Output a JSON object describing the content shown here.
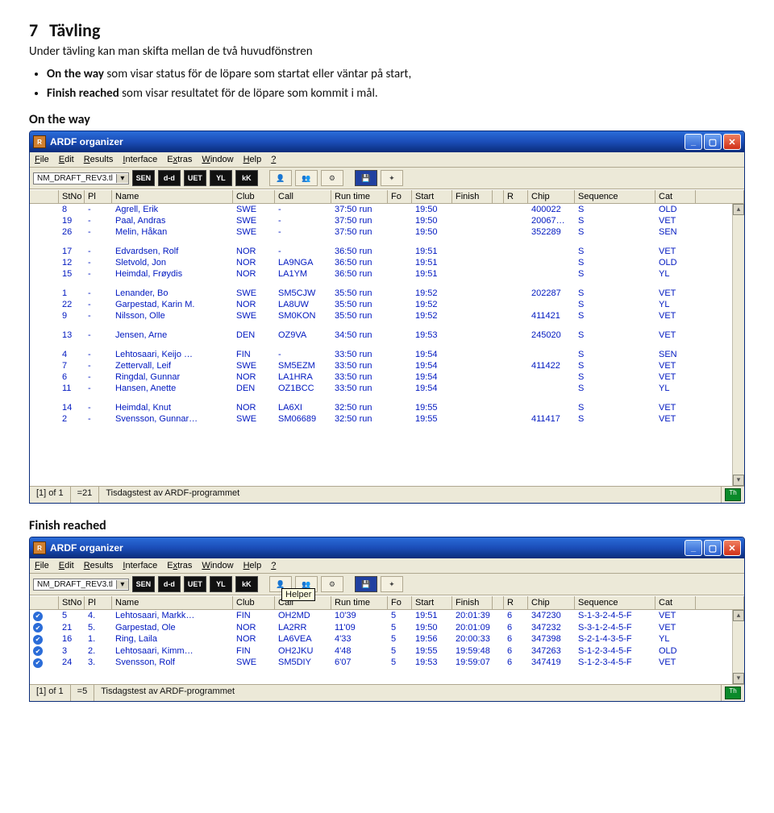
{
  "doc": {
    "section_no": "7",
    "section_title": "Tävling",
    "intro": "Under tävling kan man skifta mellan de två huvudfönstren",
    "bullets": [
      {
        "strong": "On the way",
        "rest": " som visar status för de löpare som startat eller väntar på start,"
      },
      {
        "strong": "Finish reached",
        "rest": " som visar resultatet för de löpare som kommit i mål."
      }
    ],
    "label_on_the_way": "On the way",
    "label_finish": "Finish reached"
  },
  "app": {
    "title": "ARDF organizer",
    "menus": [
      "File",
      "Edit",
      "Results",
      "Interface",
      "Extras",
      "Window",
      "Help",
      "?"
    ],
    "combo": "NM_DRAFT_REV3.tl",
    "toolbar": [
      "SEN",
      "d-d",
      "UET",
      "YL",
      "kK"
    ],
    "tooltip": "Helper",
    "headers": [
      "StNo",
      "Pl",
      "Name",
      "Club",
      "Call",
      "Run time",
      "Fo",
      "Start",
      "Finish",
      "",
      "R",
      "Chip",
      "Sequence",
      "Cat"
    ],
    "sysbtn": {
      "min": "_",
      "max": "▢",
      "close": "✕"
    },
    "status": {
      "page": "[1] of 1",
      "count1": "=21",
      "count2": "=5",
      "text": "Tisdagstest av ARDF-programmet"
    }
  },
  "ontheway": [
    [
      " ",
      "8",
      "-",
      "Agrell, Erik",
      "SWE",
      "-",
      "37:50 run",
      "",
      "19:50",
      "",
      "",
      "",
      "400022",
      "S",
      "OLD"
    ],
    [
      " ",
      "19",
      "-",
      "Paal, Andras",
      "SWE",
      "-",
      "37:50 run",
      "",
      "19:50",
      "",
      "",
      "",
      "20067…",
      "S",
      "VET"
    ],
    [
      " ",
      "26",
      "-",
      "Melin, Håkan",
      "SWE",
      "-",
      "37:50 run",
      "",
      "19:50",
      "",
      "",
      "",
      "352289",
      "S",
      "SEN"
    ],
    [
      "gap"
    ],
    [
      " ",
      "17",
      "-",
      "Edvardsen, Rolf",
      "NOR",
      "-",
      "36:50 run",
      "",
      "19:51",
      "",
      "",
      "",
      "",
      "S",
      "VET"
    ],
    [
      " ",
      "12",
      "-",
      "Sletvold, Jon",
      "NOR",
      "LA9NGA",
      "36:50 run",
      "",
      "19:51",
      "",
      "",
      "",
      "",
      "S",
      "OLD"
    ],
    [
      " ",
      "15",
      "-",
      "Heimdal, Frøydis",
      "NOR",
      "LA1YM",
      "36:50 run",
      "",
      "19:51",
      "",
      "",
      "",
      "",
      "S",
      "YL"
    ],
    [
      "gap"
    ],
    [
      " ",
      "1",
      "-",
      "Lenander, Bo",
      "SWE",
      "SM5CJW",
      "35:50 run",
      "",
      "19:52",
      "",
      "",
      "",
      "202287",
      "S",
      "VET"
    ],
    [
      " ",
      "22",
      "-",
      "Garpestad, Karin M.",
      "NOR",
      "LA8UW",
      "35:50 run",
      "",
      "19:52",
      "",
      "",
      "",
      "",
      "S",
      "YL"
    ],
    [
      " ",
      "9",
      "-",
      "Nilsson, Olle",
      "SWE",
      "SM0KON",
      "35:50 run",
      "",
      "19:52",
      "",
      "",
      "",
      "411421",
      "S",
      "VET"
    ],
    [
      "gap"
    ],
    [
      " ",
      "13",
      "-",
      "Jensen, Arne",
      "DEN",
      "OZ9VA",
      "34:50 run",
      "",
      "19:53",
      "",
      "",
      "",
      "245020",
      "S",
      "VET"
    ],
    [
      "gap"
    ],
    [
      " ",
      "4",
      "-",
      "Lehtosaari, Keijo …",
      "FIN",
      "-",
      "33:50 run",
      "",
      "19:54",
      "",
      "",
      "",
      "",
      "S",
      "SEN"
    ],
    [
      " ",
      "7",
      "-",
      "Zettervall, Leif",
      "SWE",
      "SM5EZM",
      "33:50 run",
      "",
      "19:54",
      "",
      "",
      "",
      "411422",
      "S",
      "VET"
    ],
    [
      " ",
      "6",
      "-",
      "Ringdal, Gunnar",
      "NOR",
      "LA1HRA",
      "33:50 run",
      "",
      "19:54",
      "",
      "",
      "",
      "",
      "S",
      "VET"
    ],
    [
      " ",
      "11",
      "-",
      "Hansen, Anette",
      "DEN",
      "OZ1BCC",
      "33:50 run",
      "",
      "19:54",
      "",
      "",
      "",
      "",
      "S",
      "YL"
    ],
    [
      "gap"
    ],
    [
      " ",
      "14",
      "-",
      "Heimdal, Knut",
      "NOR",
      "LA6XI",
      "32:50 run",
      "",
      "19:55",
      "",
      "",
      "",
      "",
      "S",
      "VET"
    ],
    [
      " ",
      "2",
      "-",
      "Svensson, Gunnar…",
      "SWE",
      "SM06689",
      "32:50 run",
      "",
      "19:55",
      "",
      "",
      "",
      "411417",
      "S",
      "VET"
    ]
  ],
  "finish": [
    [
      "✔",
      "5",
      "4.",
      "Lehtosaari, Markk…",
      "FIN",
      "OH2MD",
      "10'39",
      "5",
      "19:51",
      "20:01:39",
      "",
      "6",
      "347230",
      "S-1-3-2-4-5-F",
      "VET"
    ],
    [
      "✔",
      "21",
      "5.",
      "Garpestad, Ole",
      "NOR",
      "LA2RR",
      "11'09",
      "5",
      "19:50",
      "20:01:09",
      "",
      "6",
      "347232",
      "S-3-1-2-4-5-F",
      "VET"
    ],
    [
      "✔",
      "16",
      "1.",
      "Ring, Laila",
      "NOR",
      "LA6VEA",
      "4'33",
      "5",
      "19:56",
      "20:00:33",
      "",
      "6",
      "347398",
      "S-2-1-4-3-5-F",
      "YL"
    ],
    [
      "✔",
      "3",
      "2.",
      "Lehtosaari, Kimm…",
      "FIN",
      "OH2JKU",
      "4'48",
      "5",
      "19:55",
      "19:59:48",
      "",
      "6",
      "347263",
      "S-1-2-3-4-5-F",
      "OLD"
    ],
    [
      "✔",
      "24",
      "3.",
      "Svensson, Rolf",
      "SWE",
      "SM5DIY",
      "6'07",
      "5",
      "19:53",
      "19:59:07",
      "",
      "6",
      "347419",
      "S-1-2-3-4-5-F",
      "VET"
    ]
  ]
}
